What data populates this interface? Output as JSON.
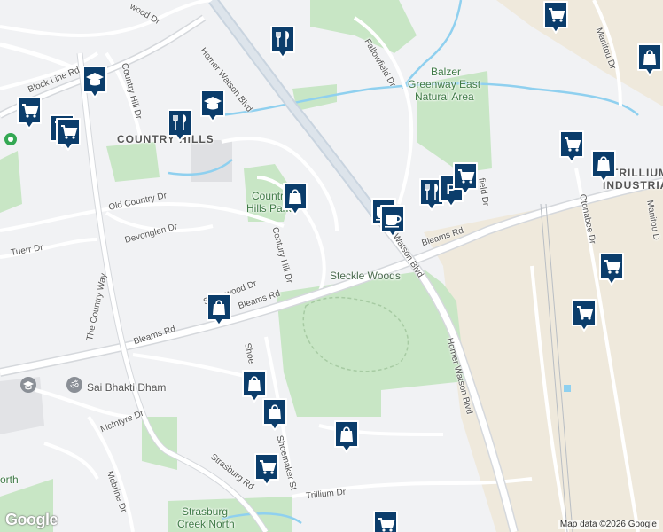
{
  "labels": {
    "homer_watson_blvd_north": "Homer Watson Blvd",
    "homer_watson_blvd_center": "Watson Blvd",
    "homer_watson_blvd_south": "Homer Watson Blvd",
    "block_line_rd": "Block Line Rd",
    "bleams_rd_west": "Bleams Rd",
    "bleams_rd_center": "Bleams Rd",
    "bleams_rd_east": "Bleams Rd",
    "country_hill_dr": "Country Hill Dr",
    "old_country_dr": "Old Country Dr",
    "devonglen_dr": "Devonglen Dr",
    "tuerr_dr": "Tuerr Dr",
    "the_country_way": "The Country Way",
    "century_hill_dr": "Century Hill Dr",
    "stonewood_dr": "Stonewood Dr",
    "fallowfield_dr": "Fallowfield Dr",
    "shoemaker_st": "Shoemaker St",
    "strasburg_rd": "Strasburg Rd",
    "trillium_dr": "Trillium Dr",
    "mcintyre_dr": "McIntyre Dr",
    "mcbrine_dr": "Mcbrine Dr",
    "otonabee_dr": "Otonabee Dr",
    "manitou_dr_north": "Manitou Dr",
    "manitou_dr_east": "Manitou D",
    "wood_dr": "wood Dr",
    "field_dr": "field Dr",
    "sh_dr": "Shoe",
    "steckle_woods": "Steckle Woods",
    "balzer_line1": "Balzer",
    "balzer_line2": "Greenway East",
    "balzer_line3": "Natural Area",
    "country_hills_district": "COUNTRY HILLS",
    "country_hills_park_line1": "Country",
    "country_hills_park_line2": "Hills Park",
    "trillium_industrial_line1": "TRILLIUM",
    "trillium_industrial_line2": "INDUSTRIAL",
    "sai_bhakti_dham": "Sai Bhakti Dham",
    "strasburg_creek_line1": "Strasburg",
    "strasburg_creek_line2": "Creek North",
    "north_partial": "orth",
    "google_logo": "Google",
    "attribution": "Map data ©2026 Google"
  },
  "pin_colors": {
    "fill": "#0b3d6b",
    "border": "#ffffff",
    "icon": "#ffffff"
  },
  "map_colors": {
    "background": "#f1f2f4",
    "park": "#c8e6c5",
    "industrial": "#efe9dc",
    "water": "#8fd0ef",
    "arterial": "#ffffff",
    "arterial_casing": "#d5d8dc",
    "highway": "#c9d4df"
  },
  "pins": [
    {
      "icon": "shopping-cart-icon"
    },
    {
      "icon": "restaurant-icon"
    },
    {
      "icon": "school-icon"
    },
    {
      "icon": "shopping-cart-icon"
    },
    {
      "icon": "shopping-cart-icon"
    },
    {
      "icon": "restaurant-icon"
    },
    {
      "icon": "school-icon"
    },
    {
      "icon": "shopping-bag-icon"
    },
    {
      "icon": "shopping-cart-icon"
    },
    {
      "icon": "shopping-bag-icon"
    },
    {
      "icon": "cafe-icon"
    },
    {
      "icon": "cafe-icon"
    },
    {
      "icon": "restaurant-icon"
    },
    {
      "icon": "parking-icon"
    },
    {
      "icon": "shopping-cart-icon"
    },
    {
      "icon": "shopping-cart-icon"
    },
    {
      "icon": "shopping-cart-icon"
    },
    {
      "icon": "shopping-bag-icon"
    },
    {
      "icon": "shopping-bag-icon"
    },
    {
      "icon": "shopping-bag-icon"
    },
    {
      "icon": "shopping-bag-icon"
    },
    {
      "icon": "shopping-cart-icon"
    },
    {
      "icon": "shopping-cart-icon"
    },
    {
      "icon": "shopping-cart-icon"
    },
    {
      "icon": "shopping-bag-icon"
    }
  ]
}
